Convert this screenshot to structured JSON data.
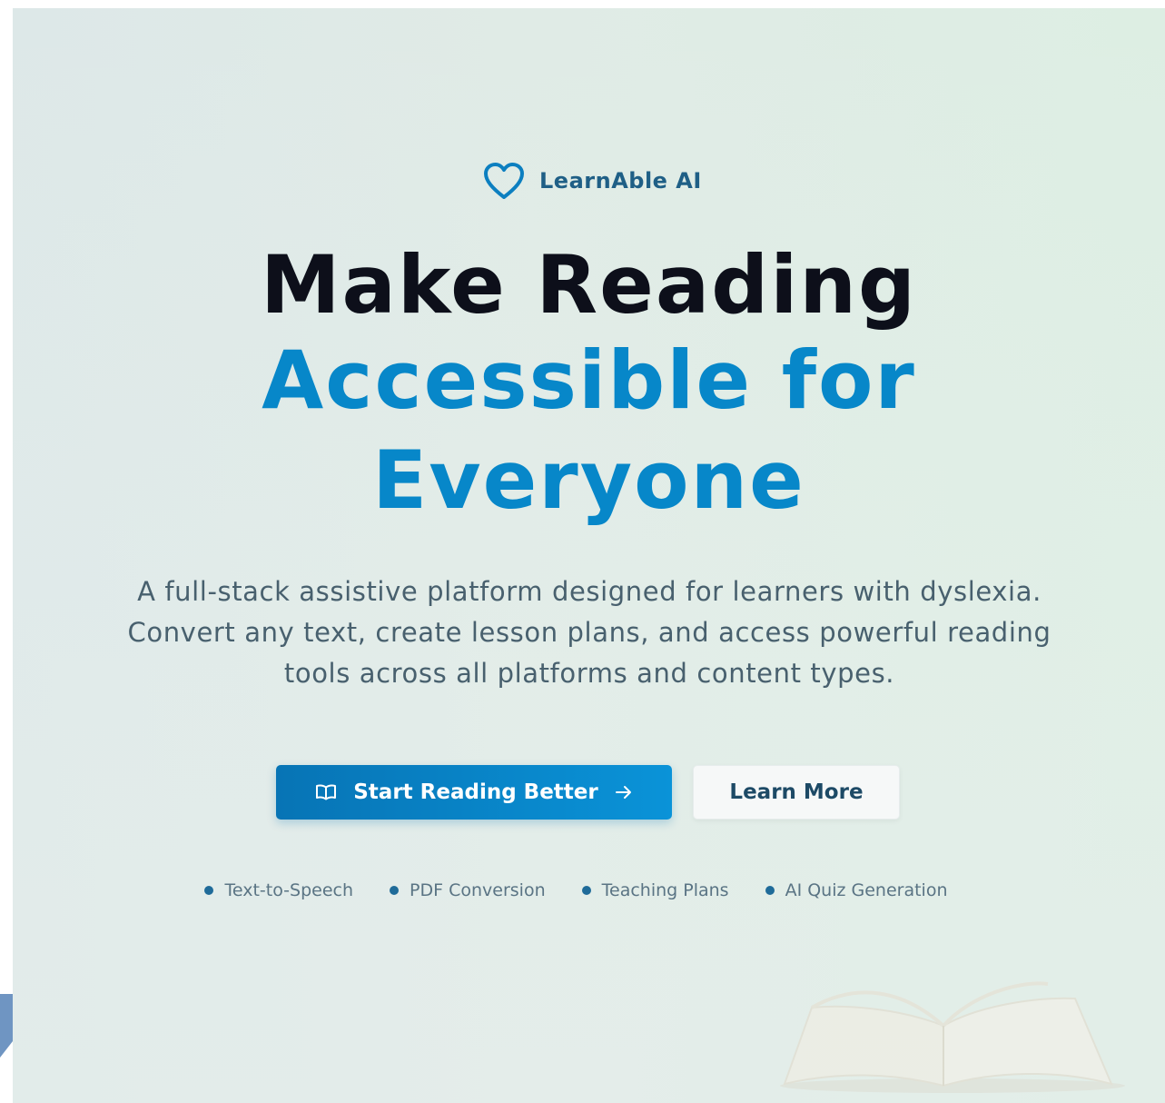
{
  "brand": {
    "name": "LearnAble AI",
    "icon": "heart-icon"
  },
  "hero": {
    "title_line1": "Make Reading",
    "title_line2": "Accessible for",
    "title_line3": "Everyone",
    "subtitle": "A full-stack assistive platform designed for learners with dyslexia. Convert any text, create lesson plans, and access powerful reading tools across all platforms and content types."
  },
  "actions": {
    "primary_label": "Start Reading Better",
    "primary_icon": "book-open-icon",
    "primary_trailing_icon": "arrow-right-icon",
    "secondary_label": "Learn More"
  },
  "features": [
    {
      "label": "Text-to-Speech"
    },
    {
      "label": "PDF Conversion"
    },
    {
      "label": "Teaching Plans"
    },
    {
      "label": "AI Quiz Generation"
    }
  ],
  "colors": {
    "accent": "#0787c9",
    "heading": "#0d0f1a",
    "brand_text": "#1f5f86",
    "body_text": "#48606e"
  }
}
